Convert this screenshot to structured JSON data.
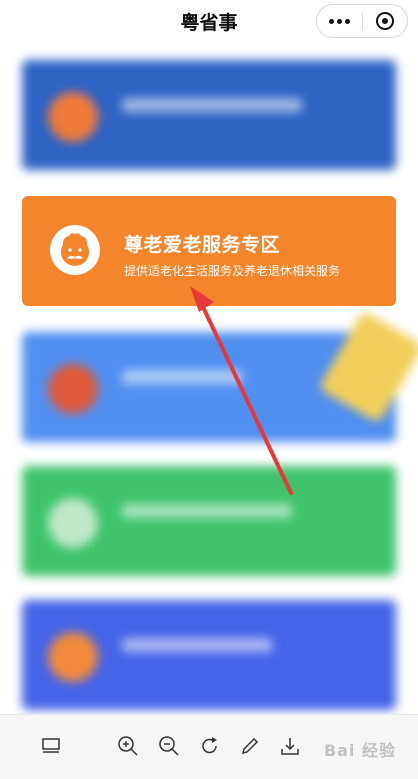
{
  "header": {
    "title": "粤省事"
  },
  "featured_card": {
    "title": "尊老爱老服务专区",
    "subtitle": "提供适老化生活服务及养老退休相关服务",
    "color": "#f5852b"
  },
  "blurred_cards": [
    {
      "color": "#2f63c4",
      "icon_color": "#f07a3a"
    },
    {
      "color": "#4f8ff0",
      "icon_color": "#e05a3a"
    },
    {
      "color": "#3fc46b",
      "icon_color": "#bfe8c8"
    },
    {
      "color": "#4564e8",
      "icon_color": "#f08a3a"
    }
  ],
  "toolbar": {
    "icons": [
      "layout-icon",
      "zoom-in-icon",
      "zoom-out-icon",
      "rotate-icon",
      "edit-icon",
      "download-icon"
    ]
  },
  "watermark": {
    "text": "Bai 经验"
  },
  "colors": {
    "arrow": "#e8393a"
  }
}
